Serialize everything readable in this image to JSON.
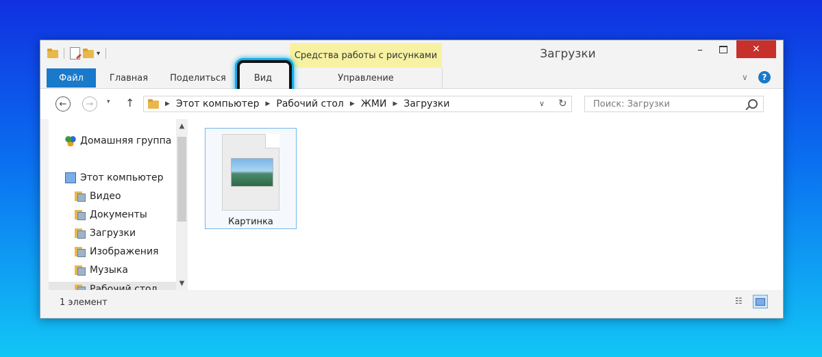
{
  "window": {
    "title": "Загрузки",
    "contextual_tab": "Средства работы с рисунками",
    "close_glyph": "✕",
    "minimize_glyph": "–"
  },
  "ribbon": {
    "tabs": [
      "Файл",
      "Главная",
      "Поделиться",
      "Вид",
      "Управление"
    ],
    "help_glyph": "?",
    "collapse_glyph": "∨"
  },
  "navigation": {
    "back_glyph": "←",
    "forward_glyph": "→",
    "recent_glyph": "▾",
    "up_glyph": "↑",
    "refresh_glyph": "↻",
    "address_path": [
      "Этот компьютер",
      "Рабочий стол",
      "ЖМИ",
      "Загрузки"
    ],
    "search_placeholder": "Поиск: Загрузки"
  },
  "sidebar": {
    "homegroup": "Домашняя группа",
    "this_pc": "Этот компьютер",
    "items": [
      "Видео",
      "Документы",
      "Загрузки",
      "Изображения",
      "Музыка",
      "Рабочий стол"
    ]
  },
  "content": {
    "files": [
      {
        "name": "Картинка",
        "type": "image"
      }
    ]
  },
  "status": {
    "item_count": "1 элемент"
  },
  "colors": {
    "file_tab": "#1979ca",
    "close_button": "#c7302b",
    "contextual_tab": "#f7f2a2",
    "highlight": "#12aee8"
  }
}
